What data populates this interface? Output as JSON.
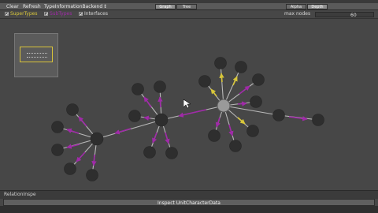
{
  "toolbar": {
    "menu": [
      "Clear",
      "Refresh",
      "TypeInformationBackend",
      "↕"
    ],
    "view_modes": [
      {
        "label": "Graph",
        "selected": true
      },
      {
        "label": "Tree",
        "selected": false
      }
    ],
    "sort_modes": [
      {
        "label": "Alpha",
        "selected": false
      },
      {
        "label": "Depth",
        "selected": true
      }
    ]
  },
  "options": {
    "supertypes_label": "SuperTypes",
    "subtypes_label": "SubTypes",
    "interfaces_label": "Interfaces",
    "max_nodes_label": "max nodes",
    "max_nodes_value": "60"
  },
  "colors": {
    "supertype": "#d8c63a",
    "subtype": "#a02aa8",
    "interface": "#c6c6c6",
    "node": "#2e2e2e",
    "root_node": "#9a9a9a",
    "edge": "#b9b9b9"
  },
  "status": {
    "label": "RelationInspe"
  },
  "action": {
    "label": "Inspect UnitCharacterData"
  }
}
